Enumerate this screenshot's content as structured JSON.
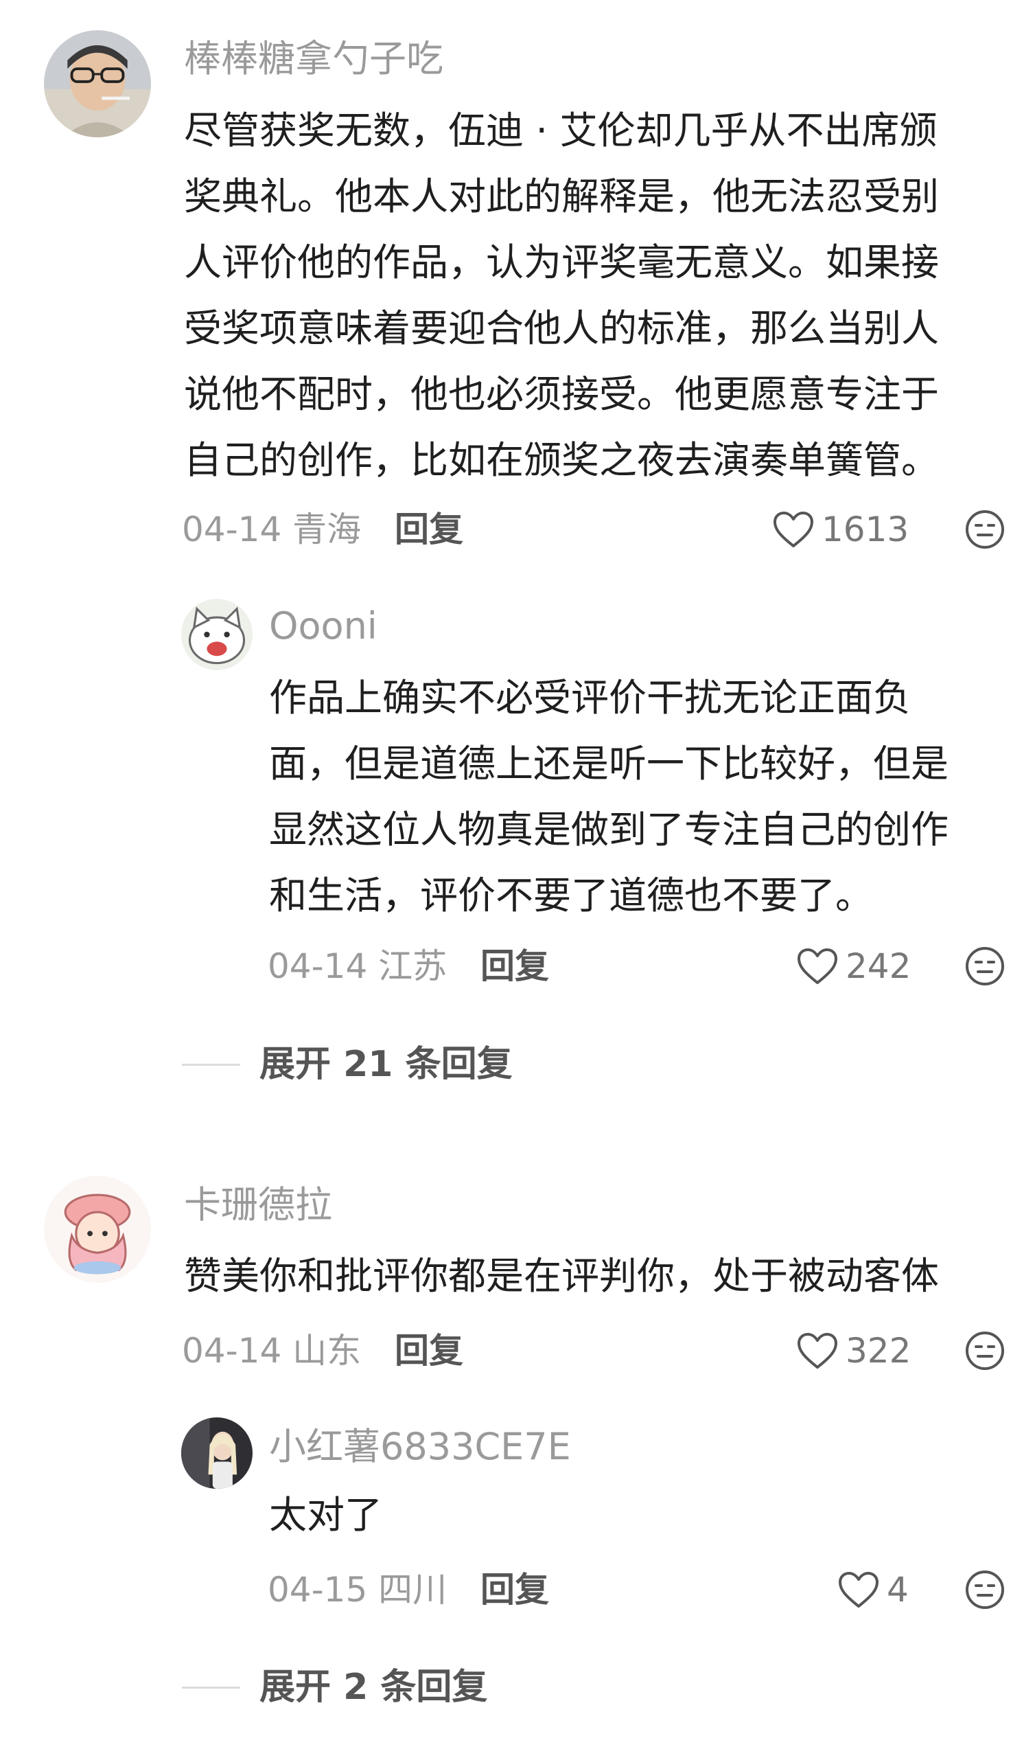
{
  "comments": [
    {
      "username": "棒棒糖拿勺子吃",
      "lines": [
        "尽管获奖无数，伍迪 · 艾伦却几乎从不出席颁",
        "奖典礼。他本人对此的解释是，他无法忍受别",
        "人评价他的作品，认为评奖毫无意义。如果接",
        "受奖项意味着要迎合他人的标准，那么当别人",
        "说他不配时，他也必须接受。他更愿意专注于",
        "自己的创作，比如在颁奖之夜去演奏单簧管。"
      ],
      "date_location": "04-14 青海",
      "reply_label": "回复",
      "like_count": "1613",
      "replies": [
        {
          "username": "Oooni",
          "lines": [
            "作品上确实不必受评价干扰无论正面负",
            "面，但是道德上还是听一下比较好，但是",
            "显然这位人物真是做到了专注自己的创作",
            "和生活，评价不要了道德也不要了。"
          ],
          "date_location": "04-14 江苏",
          "reply_label": "回复",
          "like_count": "242"
        }
      ],
      "expand_label": "展开 21 条回复"
    },
    {
      "username": "卡珊德拉",
      "lines": [
        "赞美你和批评你都是在评判你，处于被动客体"
      ],
      "date_location": "04-14 山东",
      "reply_label": "回复",
      "like_count": "322",
      "replies": [
        {
          "username": "小红薯6833CE7E",
          "lines": [
            "太对了"
          ],
          "date_location": "04-15 四川",
          "reply_label": "回复",
          "like_count": "4"
        }
      ],
      "expand_label": "展开 2 条回复"
    }
  ],
  "icons": {
    "like": "heart-outline-icon",
    "dislike": "meh-face-icon"
  },
  "colors": {
    "username": "#9a9a9a",
    "text": "#1f1f1f",
    "meta": "#9a9a9a",
    "action": "#555555",
    "icon": "#555555"
  }
}
